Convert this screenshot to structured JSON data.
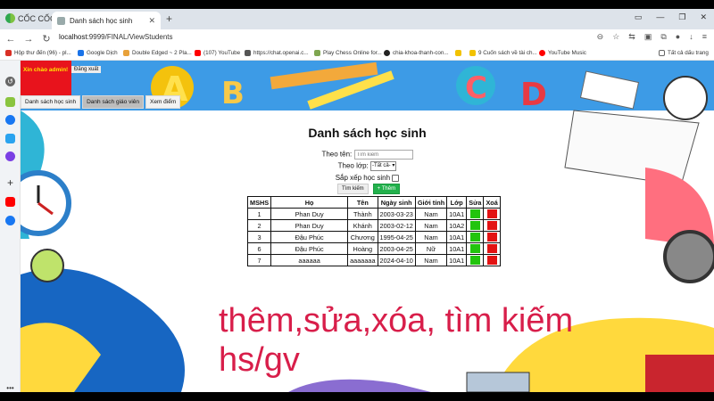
{
  "browser": {
    "brand": "CỐC CỐC",
    "tab_title": "Danh sách học sinh",
    "new_tab": "+",
    "url_host": "localhost",
    "url_path": ":9999/FINAL/ViewStudents",
    "bookmarks": [
      {
        "label": "Hộp thư đến (96) - pl...",
        "color": "#d93025"
      },
      {
        "label": "Google Dịch",
        "color": "#1a73e8"
      },
      {
        "label": "Double Edged ~ 2 Pla...",
        "color": "#e8a13a"
      },
      {
        "label": "(107) YouTube",
        "color": "#ff0000"
      },
      {
        "label": "https://chat.openai.c...",
        "color": "#555555"
      },
      {
        "label": "Play Chess Online for...",
        "color": "#7fa650"
      },
      {
        "label": "chia-khoa-thanh-con...",
        "color": "#222222"
      },
      {
        "label": "",
        "color": "#f2c200"
      },
      {
        "label": "9 Cuốn sách về tài ch...",
        "color": "#f2c200"
      },
      {
        "label": "YouTube Music",
        "color": "#ff0000"
      }
    ],
    "all_bookmarks": "Tất cả dấu trang"
  },
  "header": {
    "greeting": "Xin chào admin!",
    "logout": "Đăng xuất",
    "menu": [
      "Danh sách học sinh",
      "Danh sách giáo viên",
      "Xem điểm"
    ]
  },
  "page": {
    "title": "Danh sách học sinh",
    "search_name_label": "Theo tên:",
    "search_placeholder": "Tìm kiếm",
    "class_label": "Theo lớp:",
    "class_selected": "-Tất cả-",
    "sort_label": "Sắp xếp học sinh",
    "search_button": "Tìm kiếm",
    "add_button": "+ Thêm"
  },
  "table": {
    "headers": [
      "MSHS",
      "Họ",
      "Tên",
      "Ngày sinh",
      "Giới tính",
      "Lớp",
      "Sửa",
      "Xoá"
    ],
    "rows": [
      [
        "1",
        "Phan Duy",
        "Thành",
        "2003-03-23",
        "Nam",
        "10A1"
      ],
      [
        "2",
        "Phan Duy",
        "Khánh",
        "2003-02-12",
        "Nam",
        "10A2"
      ],
      [
        "3",
        "Đậu Phúc",
        "Chương",
        "1995-04-25",
        "Nam",
        "10A1"
      ],
      [
        "6",
        "Đậu Phúc",
        "Hoàng",
        "2003-04-25",
        "Nữ",
        "10A1"
      ],
      [
        "7",
        "aaaaaa",
        "aaaaaaa",
        "2024-04-10",
        "Nam",
        "10A1"
      ]
    ]
  },
  "overlay": {
    "line1": "thêm,sửa,xóa, tìm kiếm",
    "line2": "hs/gv"
  },
  "colors": {
    "edit": "#22c40d",
    "delete": "#e31313",
    "overlay_text": "#d81e4a",
    "admin_box": "#e8131c"
  }
}
